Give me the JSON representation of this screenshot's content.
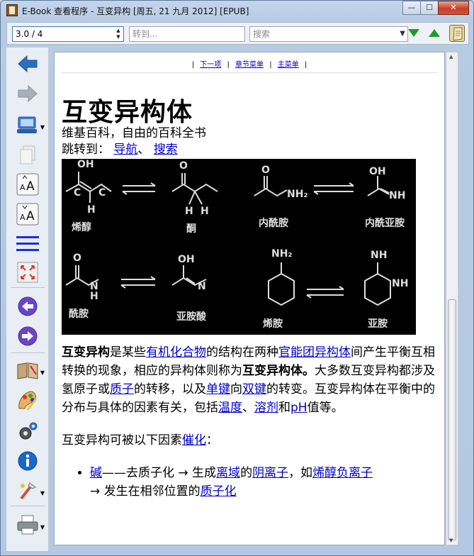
{
  "window": {
    "title": "E-Book 查看程序 - 互变异构 [周五, 21 九月 2012] [EPUB]",
    "min": "—",
    "max": "☐",
    "close": "✕"
  },
  "toolbar": {
    "page_value": "3.0 / 4",
    "goto_placeholder": "转到...",
    "search_placeholder": "搜索"
  },
  "sidebar": {
    "icons": [
      "back-arrow-icon",
      "forward-arrow-icon",
      "display-menu-icon",
      "copy-icon",
      "font-increase-icon",
      "font-decrease-icon",
      "toc-icon",
      "fullscreen-icon",
      "previous-icon",
      "next-icon",
      "library-icon",
      "preferences-icon",
      "settings-icon",
      "info-icon",
      "tools-icon",
      "print-icon"
    ]
  },
  "doc": {
    "nav": {
      "next": "下一项",
      "section": "章节菜单",
      "main": "主菜单",
      "sep": "|"
    },
    "title": "互变异构体",
    "subtitle": "维基百科，自由的百科全书",
    "jump_prefix": "跳转到：",
    "jump_nav": "导航",
    "jump_sep": "、",
    "jump_search": "搜索",
    "figure_labels": [
      "烯醇",
      "酮",
      "内酰胺",
      "内酰亚胺",
      "酰胺",
      "亚胺酸",
      "烯胺",
      "亚胺"
    ],
    "figure_atoms": [
      "OH",
      "O",
      "O",
      "OH",
      "O",
      "OH",
      "NH₂",
      "NH",
      "C",
      "C",
      "H",
      "H",
      "H",
      "NH₂",
      "NH",
      "H",
      "N",
      "N",
      "NH"
    ],
    "para1": {
      "b1": "互变异构",
      "t1": "是某些",
      "l1": "有机化合物",
      "t2": "的结构在两种",
      "l2": "官能团异构体",
      "t3": "间产生平衡互相转换的现象，相应的异构体则称为",
      "b2": "互变异构体。",
      "t4": "大多数互变异构都涉及氢原子或",
      "l3": "质子",
      "t5": "的转移，以及",
      "l4": "单键",
      "t6": "向",
      "l5": "双键",
      "t7": "的转变。互变异构体在平衡中的分布与具体的因素有关，包括",
      "l6": "温度",
      "t8": "、",
      "l7": "溶剂",
      "t9": "和",
      "l8": "pH",
      "t10": "值等。"
    },
    "para2": {
      "t1": "互变异构可被以下因素",
      "l1": "催化",
      "t2": "："
    },
    "bullet1": {
      "l1": "碱",
      "t1": "——去质子化 → 生成",
      "l2": "离域",
      "t2": "的",
      "l3": "阴离子",
      "t3": "，如",
      "l4": "烯醇负离子",
      "t4": "→ 发生在相邻位置的",
      "l5": "质子化"
    }
  }
}
